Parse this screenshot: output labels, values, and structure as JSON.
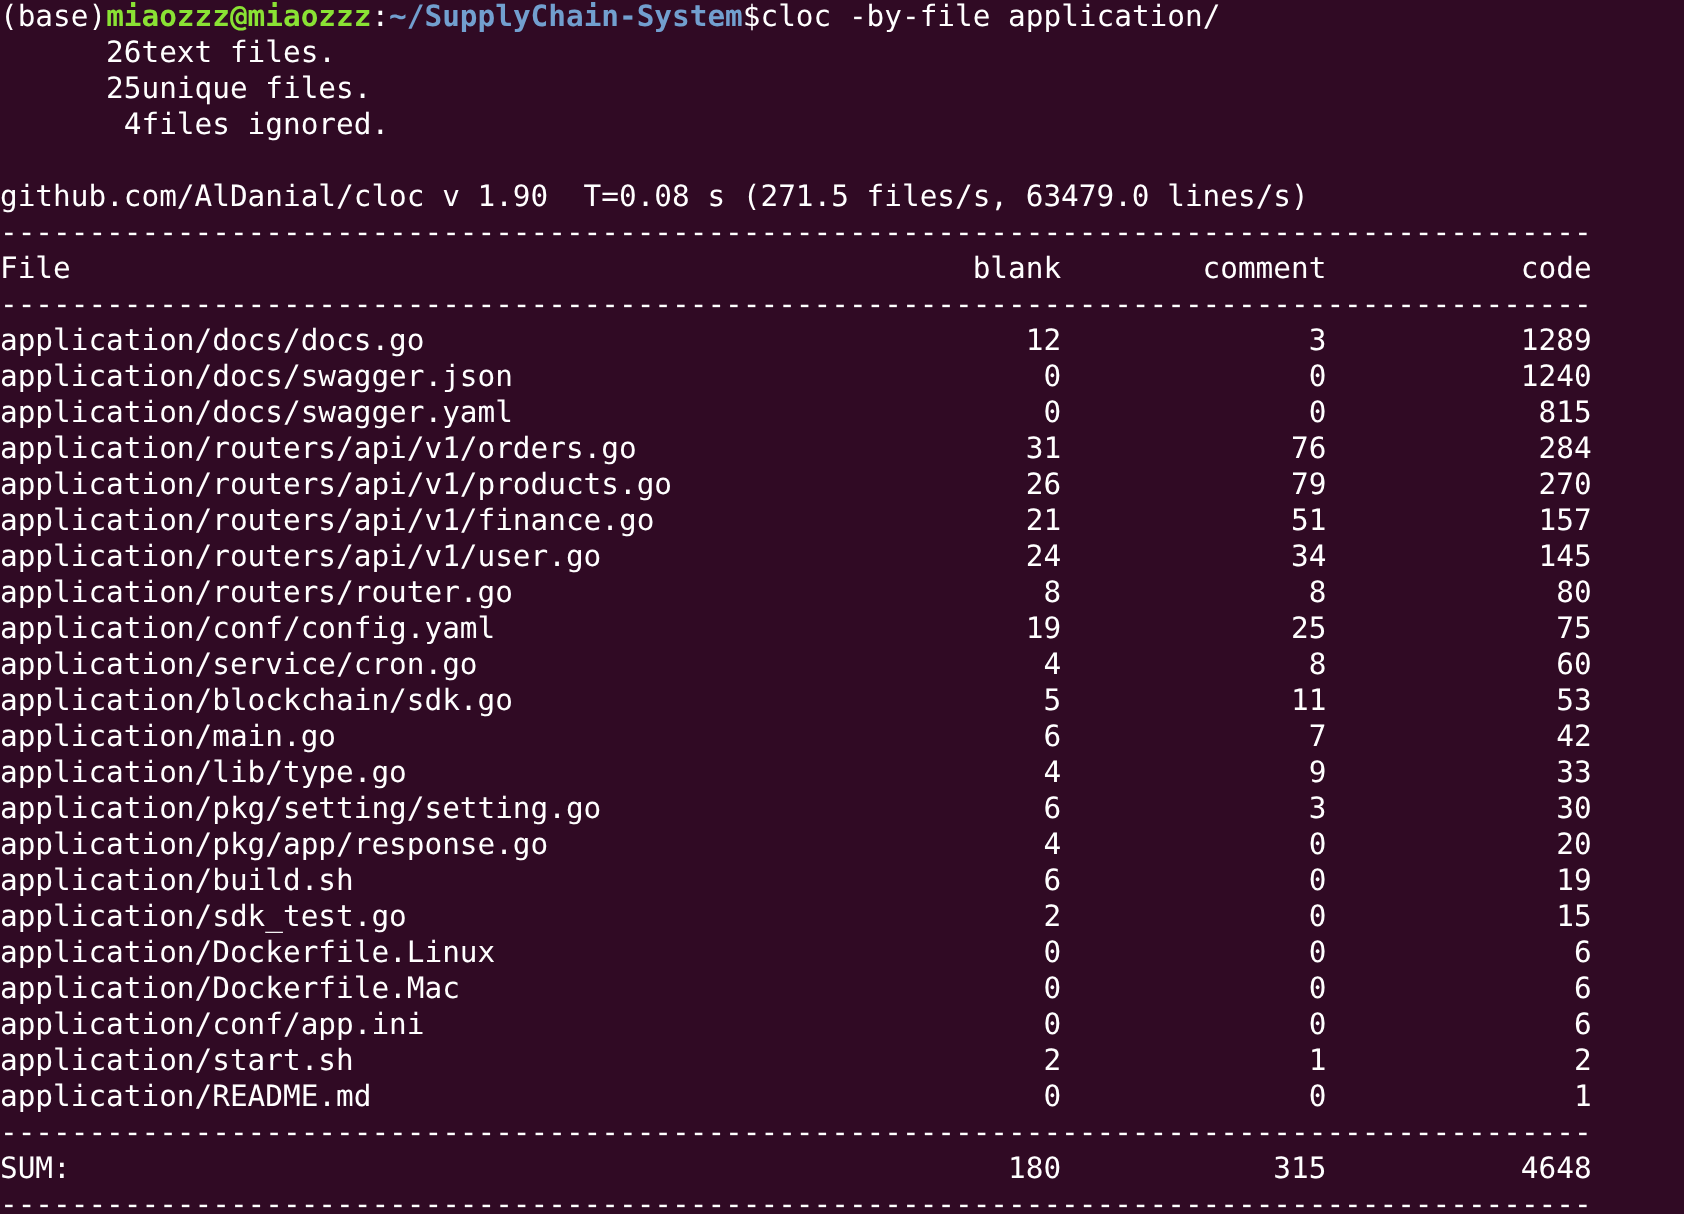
{
  "prompt": {
    "env": "(base)",
    "user_host": "miaozzz@miaozzz",
    "separator": ":",
    "path": "~/SupplyChain-System",
    "symbol": "$",
    "command": "cloc -by-file application/"
  },
  "summary": [
    {
      "count": "26",
      "text": "text files."
    },
    {
      "count": "25",
      "text": "unique files."
    },
    {
      "count": "4",
      "text": "files ignored."
    }
  ],
  "version_line": "github.com/AlDanial/cloc v 1.90  T=0.08 s (271.5 files/s, 63479.0 lines/s)",
  "rule": "------------------------------------------------------------------------------------------",
  "table": {
    "columns": [
      "File",
      "blank",
      "comment",
      "code"
    ],
    "rows": [
      [
        "application/docs/docs.go",
        "12",
        "3",
        "1289"
      ],
      [
        "application/docs/swagger.json",
        "0",
        "0",
        "1240"
      ],
      [
        "application/docs/swagger.yaml",
        "0",
        "0",
        "815"
      ],
      [
        "application/routers/api/v1/orders.go",
        "31",
        "76",
        "284"
      ],
      [
        "application/routers/api/v1/products.go",
        "26",
        "79",
        "270"
      ],
      [
        "application/routers/api/v1/finance.go",
        "21",
        "51",
        "157"
      ],
      [
        "application/routers/api/v1/user.go",
        "24",
        "34",
        "145"
      ],
      [
        "application/routers/router.go",
        "8",
        "8",
        "80"
      ],
      [
        "application/conf/config.yaml",
        "19",
        "25",
        "75"
      ],
      [
        "application/service/cron.go",
        "4",
        "8",
        "60"
      ],
      [
        "application/blockchain/sdk.go",
        "5",
        "11",
        "53"
      ],
      [
        "application/main.go",
        "6",
        "7",
        "42"
      ],
      [
        "application/lib/type.go",
        "4",
        "9",
        "33"
      ],
      [
        "application/pkg/setting/setting.go",
        "6",
        "3",
        "30"
      ],
      [
        "application/pkg/app/response.go",
        "4",
        "0",
        "20"
      ],
      [
        "application/build.sh",
        "6",
        "0",
        "19"
      ],
      [
        "application/sdk_test.go",
        "2",
        "0",
        "15"
      ],
      [
        "application/Dockerfile.Linux",
        "0",
        "0",
        "6"
      ],
      [
        "application/Dockerfile.Mac",
        "0",
        "0",
        "6"
      ],
      [
        "application/conf/app.ini",
        "0",
        "0",
        "6"
      ],
      [
        "application/start.sh",
        "2",
        "1",
        "2"
      ],
      [
        "application/README.md",
        "0",
        "0",
        "1"
      ]
    ],
    "sum": [
      "SUM:",
      "180",
      "315",
      "4648"
    ]
  }
}
